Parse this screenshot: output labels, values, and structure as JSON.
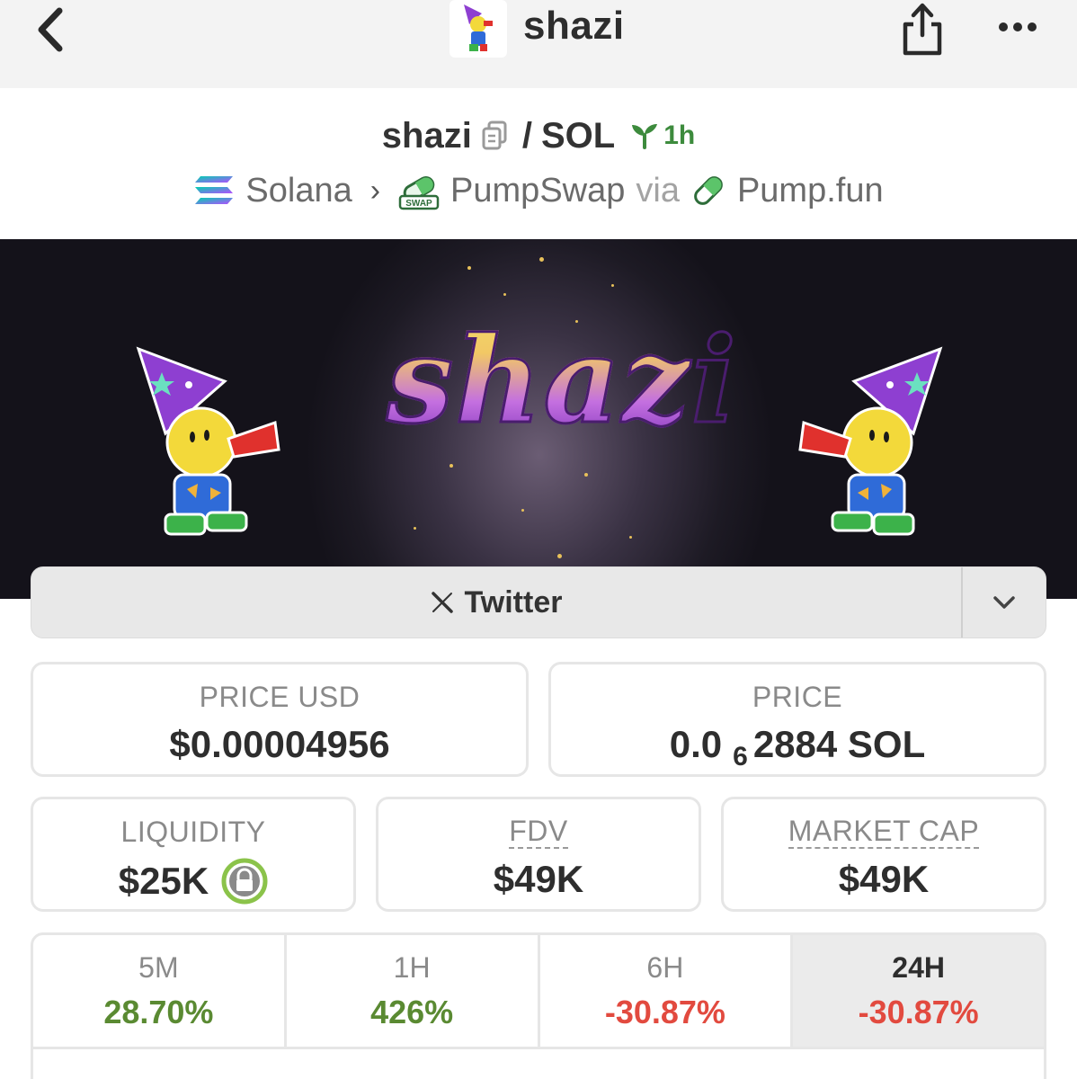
{
  "header": {
    "title": "shazi"
  },
  "pair": {
    "base": "shazi",
    "separator": "/",
    "quote": "SOL",
    "age": "1h"
  },
  "route": {
    "chain": "Solana",
    "dex": "PumpSwap",
    "via": "via",
    "launchpad": "Pump.fun",
    "dex_badge": "SWAP"
  },
  "banner": {
    "title": "shazi"
  },
  "social": {
    "twitter_label": "Twitter"
  },
  "stats": {
    "price_usd": {
      "label": "PRICE USD",
      "value": "$0.00004956"
    },
    "price": {
      "label": "PRICE",
      "value_prefix": "0.0",
      "zero_count": "6",
      "value_suffix": "2884 SOL"
    },
    "liquidity": {
      "label": "LIQUIDITY",
      "value": "$25K"
    },
    "fdv": {
      "label": "FDV",
      "value": "$49K"
    },
    "market_cap": {
      "label": "MARKET CAP",
      "value": "$49K"
    }
  },
  "timeframes": [
    {
      "label": "5M",
      "value": "28.70%",
      "trend": "up"
    },
    {
      "label": "1H",
      "value": "426%",
      "trend": "up"
    },
    {
      "label": "6H",
      "value": "-30.87%",
      "trend": "down"
    },
    {
      "label": "24H",
      "value": "-30.87%",
      "trend": "down",
      "active": true
    }
  ],
  "colors": {
    "positive": "#5a8a32",
    "negative": "#e24a3f",
    "age_green": "#3d8b3d",
    "lock_green": "#8bc34a"
  },
  "icons": {
    "back": "chevron-left-icon",
    "share": "share-icon",
    "more": "more-horizontal-icon",
    "copy": "copy-icon",
    "age": "seedling-icon",
    "chain": "solana-icon",
    "dex": "pumpswap-icon",
    "launchpad": "pill-icon",
    "twitter": "x-logo-icon",
    "toggle": "chevron-down-icon",
    "lock": "lock-icon"
  }
}
